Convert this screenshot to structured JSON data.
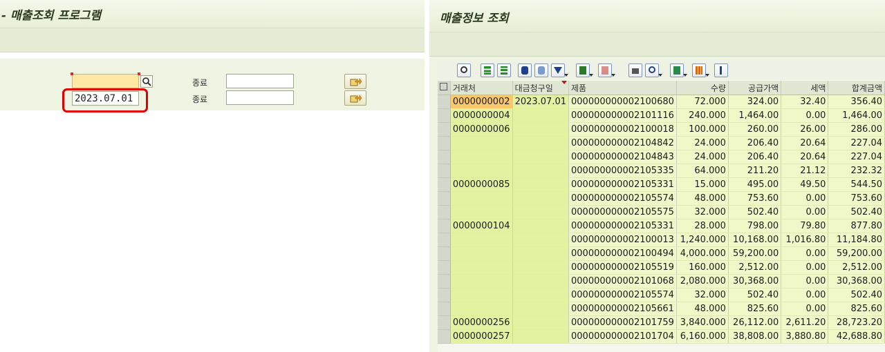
{
  "left_window": {
    "title": "- 매출조회 프로그램",
    "row1": {
      "from_value": "",
      "end_label": "종료",
      "end_value": ""
    },
    "row2": {
      "from_value": "2023.07.01",
      "end_label": "종료",
      "end_value": ""
    }
  },
  "right_window": {
    "title": "매출정보 조회",
    "columns": [
      "거래처",
      "대금청구일",
      "제품",
      "수량",
      "공급가액",
      "세액",
      "합계금액"
    ],
    "rows": [
      [
        "0000000002",
        "2023.07.01",
        "000000000002100680",
        "72.000",
        "324.00",
        "32.40",
        "356.40"
      ],
      [
        "0000000004",
        "",
        "000000000002101116",
        "240.000",
        "1,464.00",
        "0.00",
        "1,464.00"
      ],
      [
        "0000000006",
        "",
        "000000000002100018",
        "100.000",
        "260.00",
        "26.00",
        "286.00"
      ],
      [
        "",
        "",
        "000000000002104842",
        "24.000",
        "206.40",
        "20.64",
        "227.04"
      ],
      [
        "",
        "",
        "000000000002104843",
        "24.000",
        "206.40",
        "20.64",
        "227.04"
      ],
      [
        "",
        "",
        "000000000002105335",
        "64.000",
        "211.20",
        "21.12",
        "232.32"
      ],
      [
        "0000000085",
        "",
        "000000000002105331",
        "15.000",
        "495.00",
        "49.50",
        "544.50"
      ],
      [
        "",
        "",
        "000000000002105574",
        "48.000",
        "753.60",
        "0.00",
        "753.60"
      ],
      [
        "",
        "",
        "000000000002105575",
        "32.000",
        "502.40",
        "0.00",
        "502.40"
      ],
      [
        "0000000104",
        "",
        "000000000002105331",
        "28.000",
        "798.00",
        "79.80",
        "877.80"
      ],
      [
        "",
        "",
        "000000000002100013",
        "1,240.000",
        "10,168.00",
        "1,016.80",
        "11,184.80"
      ],
      [
        "",
        "",
        "000000000002100494",
        "4,000.000",
        "59,200.00",
        "0.00",
        "59,200.00"
      ],
      [
        "",
        "",
        "000000000002105519",
        "160.000",
        "2,512.00",
        "0.00",
        "2,512.00"
      ],
      [
        "",
        "",
        "000000000002101068",
        "2,080.000",
        "30,368.00",
        "0.00",
        "30,368.00"
      ],
      [
        "",
        "",
        "000000000002105574",
        "32.000",
        "502.40",
        "0.00",
        "502.40"
      ],
      [
        "",
        "",
        "000000000002105661",
        "48.000",
        "825.60",
        "0.00",
        "825.60"
      ],
      [
        "0000000256",
        "",
        "000000000002101759",
        "3,840.000",
        "26,112.00",
        "2,611.20",
        "28,723.20"
      ],
      [
        "0000000257",
        "",
        "000000000002101704",
        "6,160.000",
        "38,808.00",
        "3,880.80",
        "42,688.80"
      ]
    ]
  },
  "colors": {
    "key_column": "#e3f2a0",
    "value_cell": "#f1f8c8",
    "current_cell": "#f9c86b",
    "highlight_box": "#e00000"
  }
}
